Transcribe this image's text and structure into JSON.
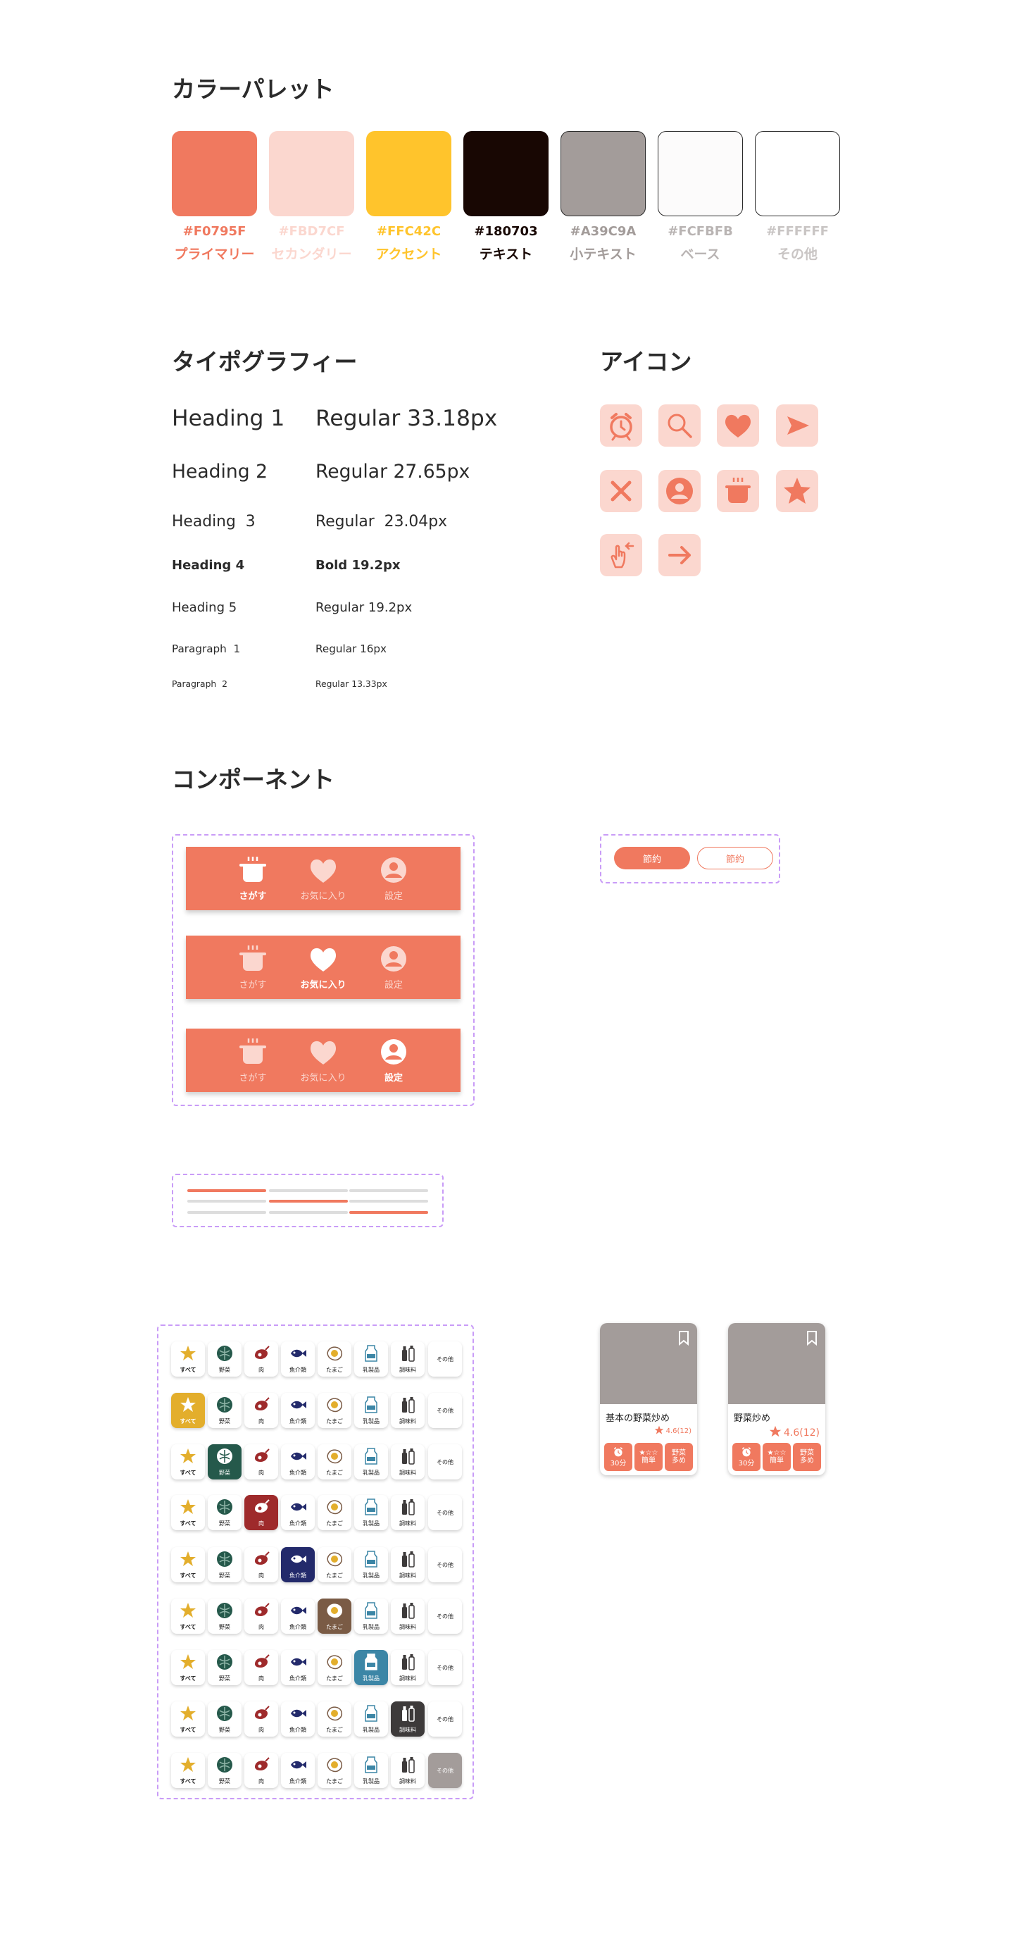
{
  "palette": {
    "title": "カラーパレット",
    "colors": [
      {
        "hex": "#F0795F",
        "name": "プライマリー",
        "text_color": "#F0795F",
        "bordered": false
      },
      {
        "hex": "#FBD7CF",
        "name": "セカンダリー",
        "text_color": "#FBD7CF",
        "bordered": false
      },
      {
        "hex": "#FFC42C",
        "name": "アクセント",
        "text_color": "#FFC42C",
        "bordered": false
      },
      {
        "hex": "#180703",
        "name": "テキスト",
        "text_color": "#180703",
        "bordered": false
      },
      {
        "hex": "#A39C9A",
        "name": "小テキスト",
        "text_color": "#A39C9A",
        "bordered": true
      },
      {
        "hex": "#FCFBFB",
        "name": "ベース",
        "text_color": "#b9b4b3",
        "bordered": true
      },
      {
        "hex": "#FFFFFF",
        "name": "その他",
        "text_color": "#c9c5c4",
        "bordered": true
      }
    ]
  },
  "typography": {
    "title": "タイポグラフィー",
    "rows": [
      {
        "label": "Heading 1",
        "spec": "Regular 33.18px"
      },
      {
        "label": "Heading 2",
        "spec": "Regular 27.65px"
      },
      {
        "label": "Heading  3",
        "spec": "Regular  23.04px"
      },
      {
        "label": "Heading 4",
        "spec": "Bold 19.2px"
      },
      {
        "label": "Heading 5",
        "spec": "Regular 19.2px"
      },
      {
        "label": "Paragraph  1",
        "spec": "Regular 16px"
      },
      {
        "label": "Paragraph  2",
        "spec": "Regular 13.33px"
      }
    ]
  },
  "icons": {
    "title": "アイコン",
    "items": [
      "alarm-clock-icon",
      "search-icon",
      "heart-icon",
      "send-icon",
      "close-icon",
      "user-icon",
      "pot-icon",
      "star-icon",
      "swipe-hand-icon",
      "arrow-right-icon"
    ]
  },
  "components": {
    "title": "コンポーネント",
    "nav_labels": [
      "さがす",
      "お気に入り",
      "設定"
    ],
    "nav_active": [
      0,
      1,
      2
    ],
    "buttons": {
      "filled": "節約",
      "outline": "節約"
    },
    "progress_active": [
      0,
      1,
      2
    ],
    "categories": [
      {
        "label": "すべて",
        "active_color": "#E3AE2C"
      },
      {
        "label": "野菜",
        "active_color": "#25594B"
      },
      {
        "label": "肉",
        "active_color": "#9E2A2B"
      },
      {
        "label": "魚介類",
        "active_color": "#232A6B"
      },
      {
        "label": "たまご",
        "active_color": "#7A5B45"
      },
      {
        "label": "乳製品",
        "active_color": "#3C86A6"
      },
      {
        "label": "調味料",
        "active_color": "#3D3A3A"
      },
      {
        "label": "その他",
        "active_color": "#A39C9A"
      }
    ],
    "category_rows_active": [
      null,
      0,
      1,
      2,
      3,
      4,
      5,
      6,
      7
    ],
    "cards": [
      {
        "title": "基本の野菜炒め",
        "rating": "4.6(12)",
        "chips": [
          [
            "30分"
          ],
          [
            "★☆☆",
            "簡単"
          ],
          [
            "野菜",
            "多め"
          ]
        ]
      },
      {
        "title": "野菜炒め",
        "rating": "4.6(12)",
        "chips": [
          [
            "30分"
          ],
          [
            "★☆☆",
            "簡単"
          ],
          [
            "野菜",
            "多め"
          ]
        ]
      }
    ]
  }
}
